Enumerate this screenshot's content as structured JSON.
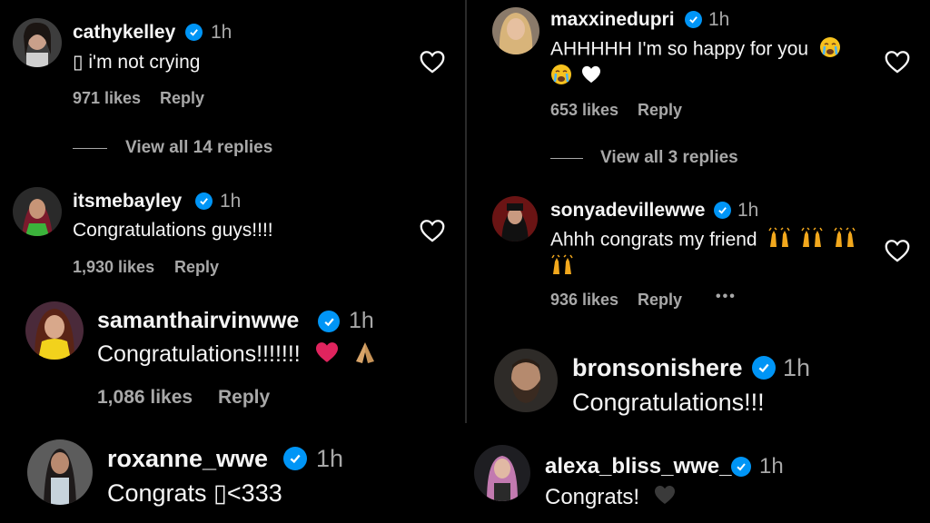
{
  "comments": {
    "cathy": {
      "username": "cathykelley",
      "time": "1h",
      "text": "▯ i'm not crying",
      "likes": "971 likes",
      "reply": "Reply",
      "view_replies": "View all 14 replies"
    },
    "bayley": {
      "username": "itsmebayley",
      "time": "1h",
      "text": "Congratulations guys!!!!",
      "likes": "1,930 likes",
      "reply": "Reply"
    },
    "samantha": {
      "username": "samanthairvinwwe",
      "time": "1h",
      "text": "Congratulations!!!!!!!",
      "likes": "1,086 likes",
      "reply": "Reply"
    },
    "roxanne": {
      "username": "roxanne_wwe",
      "time": "1h",
      "text": "Congrats ▯<333"
    },
    "maxxine": {
      "username": "maxxinedupri",
      "time": "1h",
      "text": "AHHHHH I'm so happy for you",
      "likes": "653 likes",
      "reply": "Reply",
      "view_replies": "View all 3 replies"
    },
    "sonya": {
      "username": "sonyadevillewwe",
      "time": "1h",
      "text": "Ahhh congrats my friend",
      "likes": "936 likes",
      "reply": "Reply",
      "more": "•••"
    },
    "bronson": {
      "username": "bronsonishere",
      "time": "1h",
      "text": "Congratulations!!!"
    },
    "alexa": {
      "username": "alexa_bliss_wwe_",
      "time": "1h",
      "text": "Congrats!"
    }
  },
  "colors": {
    "background": "#000000",
    "text": "#f5f5f5",
    "secondary": "#a8a8a8",
    "verified": "#0095f6",
    "heart_red": "#e0245e"
  },
  "icons": [
    "verified-badge-icon",
    "heart-outline-icon",
    "crying-face-emoji",
    "white-heart-emoji",
    "red-heart-emoji",
    "folded-hands-emoji",
    "raising-hands-emoji",
    "black-heart-emoji"
  ]
}
